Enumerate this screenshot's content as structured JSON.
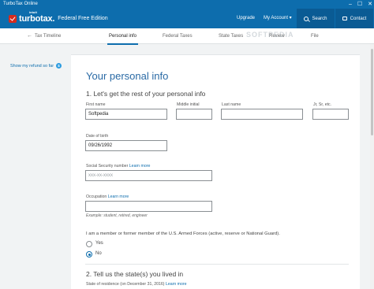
{
  "window": {
    "title": "TurboTax Online",
    "controls": [
      "–",
      "☐",
      "✕"
    ]
  },
  "header": {
    "logo_intuit": "intuit",
    "logo_text": "turbotax.",
    "edition": "Federal Free Edition",
    "upgrade": "Upgrade",
    "my_account": "My Account ▾",
    "search": "Search",
    "contact": "Contact"
  },
  "tabs": {
    "back": "Tax Timeline",
    "items": [
      "Personal info",
      "Federal Taxes",
      "State Taxes",
      "Review",
      "File"
    ],
    "active": "Personal info"
  },
  "watermark": "SOFTPEDIA",
  "sidebar": {
    "refund_link": "Show my refund so far",
    "refund_badge": "$"
  },
  "form": {
    "page_title": "Your personal info",
    "section1": "1. Let's get the rest of your personal info",
    "first_name": {
      "label": "First name",
      "value": "Softpedia"
    },
    "middle_initial": {
      "label": "Middle initial",
      "value": ""
    },
    "last_name": {
      "label": "Last name",
      "value": ""
    },
    "suffix": {
      "label": "Jr, Sr, etc.",
      "value": ""
    },
    "dob": {
      "label": "Date of birth",
      "value": "09/26/1992"
    },
    "ssn": {
      "label": "Social Security number",
      "learn_more": "Learn more",
      "placeholder": "xxx-xx-xxxx"
    },
    "occupation": {
      "label": "Occupation",
      "learn_more": "Learn more",
      "value": "",
      "hint": "Example: student, retired, engineer"
    },
    "military_question": "I am a member or former member of the U.S. Armed Forces (active, reserve or National Guard).",
    "military_options": [
      "Yes",
      "No"
    ],
    "military_selected": "No",
    "section2": "2. Tell us the state(s) you lived in",
    "state_label": "State of residence (on December 31, 2016)",
    "state_learn_more": "Learn more"
  }
}
